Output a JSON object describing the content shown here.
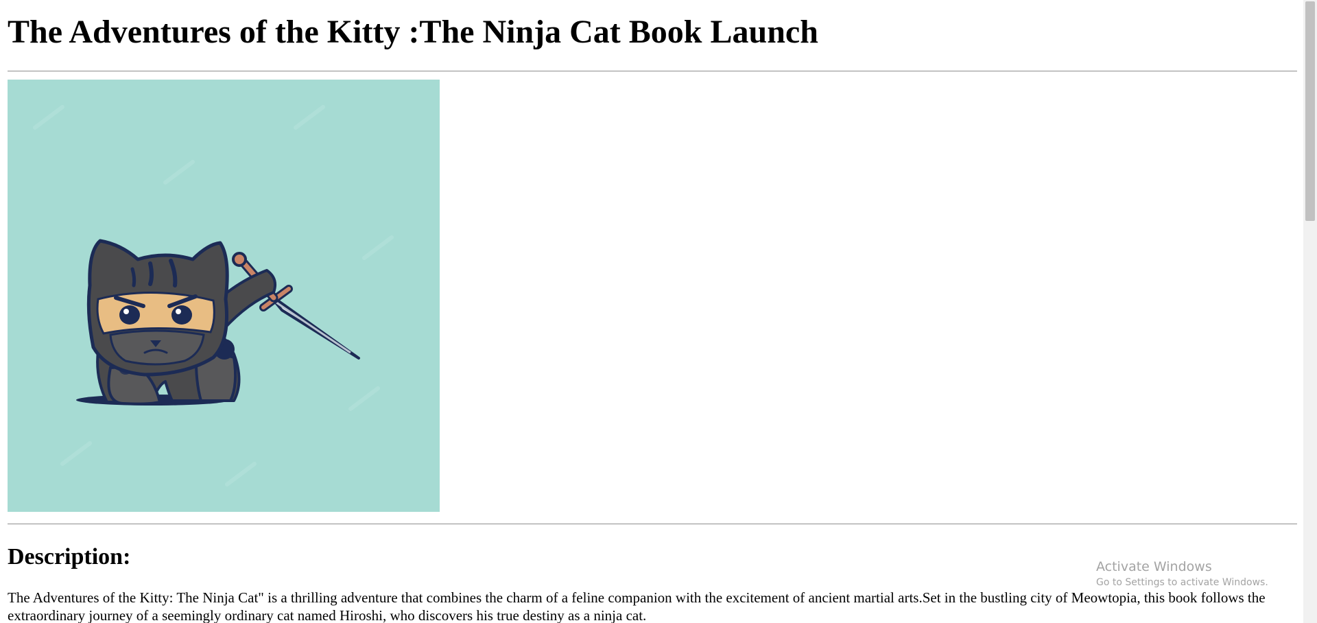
{
  "page": {
    "title": "The Adventures of the Kitty :The Ninja Cat Book Launch"
  },
  "cover": {
    "background_color": "#a6dbd3",
    "icon": "ninja-cat-with-sword"
  },
  "description": {
    "heading": "Description:",
    "text": "The Adventures of the Kitty: The Ninja Cat\" is a thrilling adventure that combines the charm of a feline companion with the excitement of ancient martial arts.Set in the bustling city of Meowtopia, this book follows the extraordinary journey of a seemingly ordinary cat named Hiroshi, who discovers his true destiny as a ninja cat."
  },
  "system_watermark": {
    "title": "Activate Windows",
    "subtitle": "Go to Settings to activate Windows."
  }
}
